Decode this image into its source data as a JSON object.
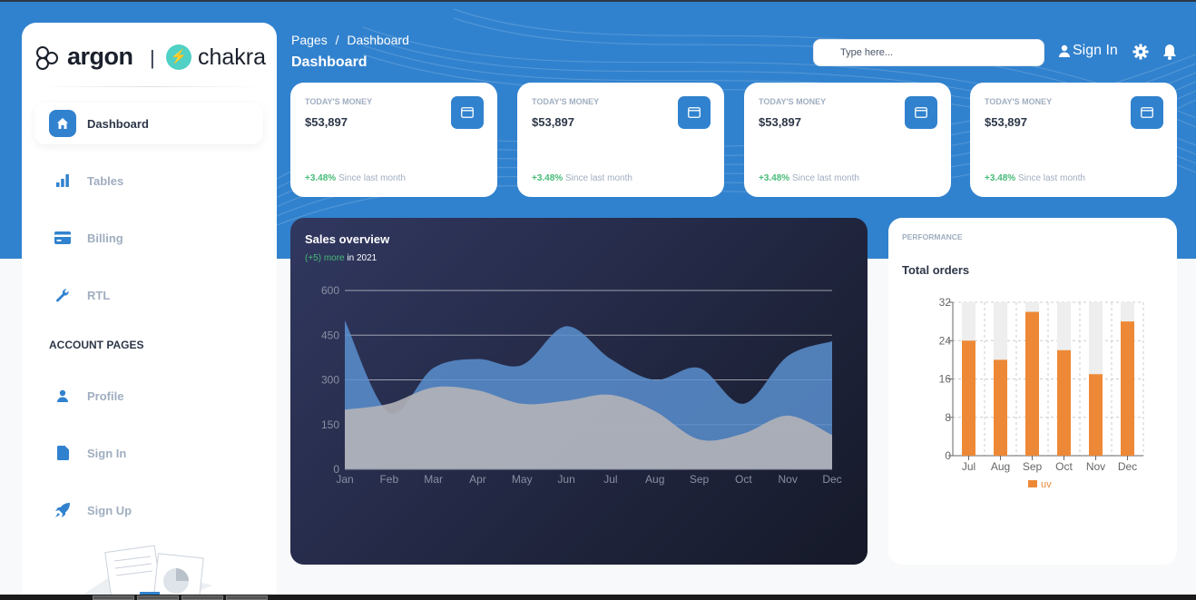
{
  "brand": {
    "argon": "argon",
    "separator": "|",
    "chakra": "chakra"
  },
  "sidebar": {
    "items": [
      {
        "label": "Dashboard"
      },
      {
        "label": "Tables"
      },
      {
        "label": "Billing"
      },
      {
        "label": "RTL"
      }
    ],
    "section_title": "ACCOUNT PAGES",
    "account_items": [
      {
        "label": "Profile"
      },
      {
        "label": "Sign In"
      },
      {
        "label": "Sign Up"
      }
    ]
  },
  "header": {
    "breadcrumb_root": "Pages",
    "breadcrumb_sep": "/",
    "breadcrumb_current": "Dashboard",
    "title": "Dashboard",
    "search_placeholder": "Type here...",
    "signin_label": "Sign In"
  },
  "stats": [
    {
      "title": "TODAY'S MONEY",
      "value": "$53,897",
      "pct": "+3.48%",
      "since": "Since last month"
    },
    {
      "title": "TODAY'S MONEY",
      "value": "$53,897",
      "pct": "+3.48%",
      "since": "Since last month"
    },
    {
      "title": "TODAY'S MONEY",
      "value": "$53,897",
      "pct": "+3.48%",
      "since": "Since last month"
    },
    {
      "title": "TODAY'S MONEY",
      "value": "$53,897",
      "pct": "+3.48%",
      "since": "Since last month"
    }
  ],
  "sales": {
    "title": "Sales overview",
    "sub_green": "(+5) more",
    "sub_rest": " in 2021"
  },
  "performance": {
    "label": "PERFORMANCE",
    "title": "Total orders"
  },
  "colors": {
    "primary": "#3182ce",
    "green": "#48bb78",
    "orange": "#ed8936",
    "area_blue": "#5b8fcf",
    "area_gray": "#b3b3b8"
  },
  "chart_data": [
    {
      "type": "area",
      "x": [
        "Jan",
        "Feb",
        "Mar",
        "Apr",
        "May",
        "Jun",
        "Jul",
        "Aug",
        "Sep",
        "Oct",
        "Nov",
        "Dec"
      ],
      "series": [
        {
          "values": [
            500,
            190,
            340,
            370,
            350,
            480,
            370,
            300,
            340,
            220,
            380,
            430
          ]
        },
        {
          "values": [
            200,
            220,
            275,
            265,
            220,
            230,
            250,
            195,
            100,
            120,
            180,
            115
          ]
        }
      ],
      "yticks": [
        0,
        150,
        300,
        450,
        600
      ],
      "ylim": [
        0,
        600
      ],
      "grid": true
    },
    {
      "type": "bar",
      "categories": [
        "Jul",
        "Aug",
        "Sep",
        "Oct",
        "Nov",
        "Dec"
      ],
      "series": [
        {
          "name": "uv",
          "values": [
            24,
            20,
            30,
            22,
            17,
            28
          ]
        }
      ],
      "background_max": 32,
      "yticks": [
        0,
        8,
        16,
        24,
        32
      ],
      "ylim": [
        0,
        32
      ],
      "legend": "bottom"
    }
  ]
}
